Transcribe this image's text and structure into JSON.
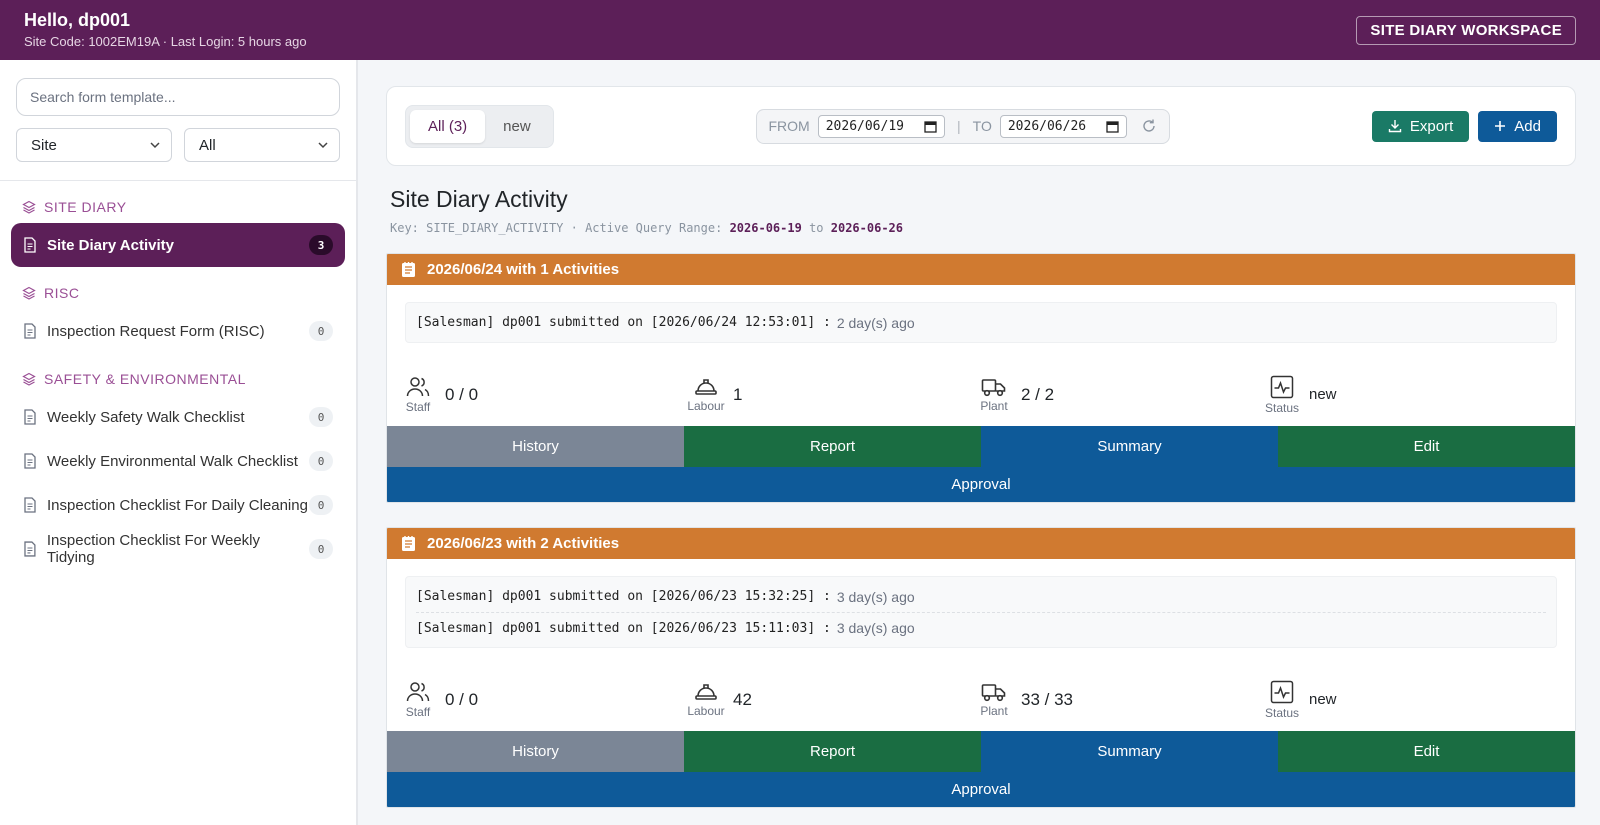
{
  "header": {
    "greeting": "Hello, dp001",
    "subline": "Site Code: 1002EM19A · Last Login: 5 hours ago",
    "workspace_label": "SITE DIARY WORKSPACE"
  },
  "sidebar": {
    "search_placeholder": "Search form template...",
    "filter1": "Site",
    "filter2": "All",
    "sections": [
      {
        "title": "SITE DIARY",
        "items": [
          {
            "label": "Site Diary Activity",
            "count": "3",
            "active": true
          }
        ]
      },
      {
        "title": "RISC",
        "items": [
          {
            "label": "Inspection Request Form (RISC)",
            "count": "0"
          }
        ]
      },
      {
        "title": "SAFETY & ENVIRONMENTAL",
        "items": [
          {
            "label": "Weekly Safety Walk Checklist",
            "count": "0"
          },
          {
            "label": "Weekly Environmental Walk Checklist",
            "count": "0"
          },
          {
            "label": "Inspection Checklist For Daily Cleaning",
            "count": "0"
          },
          {
            "label": "Inspection Checklist For Weekly Tidying",
            "count": "0"
          }
        ]
      }
    ]
  },
  "toolbar": {
    "tab_all": "All (3)",
    "tab_new": "new",
    "from_label": "FROM",
    "from_value": "2026/06/19",
    "sep": "|",
    "to_label": "TO",
    "to_value": "2026/06/26",
    "export_label": "Export",
    "add_label": "Add"
  },
  "page": {
    "title": "Site Diary Activity",
    "key_prefix": "Key: SITE_DIARY_ACTIVITY · Active Query Range:",
    "range_from": "2026-06-19",
    "range_to_word": "to",
    "range_to": "2026-06-26"
  },
  "cards": [
    {
      "heading": "2026/06/24 with 1 Activities",
      "logs": [
        {
          "text": "[Salesman] dp001 submitted on [2026/06/24 12:53:01] :",
          "ago": "2 day(s) ago"
        }
      ],
      "staff": "0 / 0",
      "labour": "1",
      "plant": "2 / 2",
      "status": "new"
    },
    {
      "heading": "2026/06/23 with 2 Activities",
      "logs": [
        {
          "text": "[Salesman] dp001 submitted on [2026/06/23 15:32:25] :",
          "ago": "3 day(s) ago"
        },
        {
          "text": "[Salesman] dp001 submitted on [2026/06/23 15:11:03] :",
          "ago": "3 day(s) ago"
        }
      ],
      "staff": "0 / 0",
      "labour": "42",
      "plant": "33 / 33",
      "status": "new"
    }
  ],
  "labels": {
    "staff": "Staff",
    "labour": "Labour",
    "plant": "Plant",
    "status": "Status",
    "history": "History",
    "report": "Report",
    "summary": "Summary",
    "edit": "Edit",
    "approval": "Approval"
  },
  "colors": {
    "brand": "#5c1f58",
    "card_header": "#d07a30",
    "primary": "#0e5a99",
    "success": "#1a6d42"
  }
}
